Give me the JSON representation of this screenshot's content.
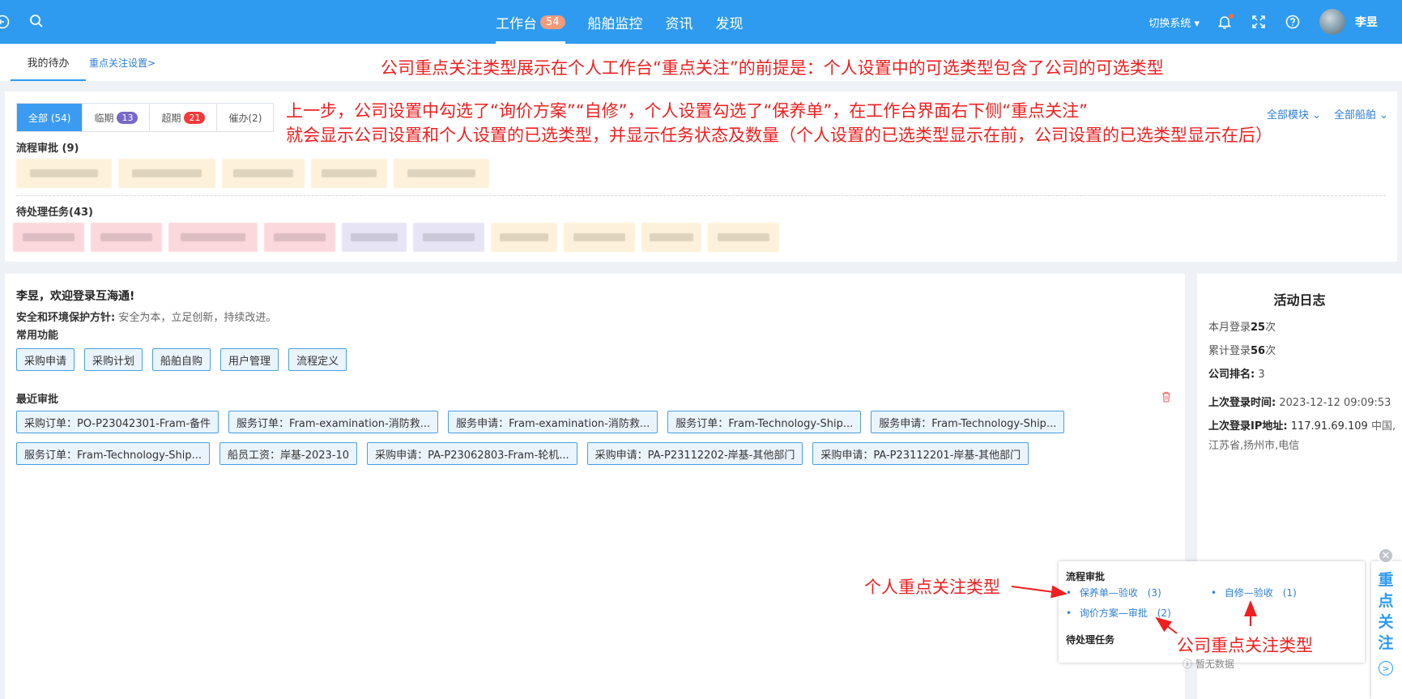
{
  "header": {
    "nav": [
      {
        "label": "工作台",
        "badge": "54"
      },
      {
        "label": "船舶监控"
      },
      {
        "label": "资讯"
      },
      {
        "label": "发现"
      }
    ],
    "switch_label": "切换系统",
    "user_name": "李昱"
  },
  "tabs": {
    "mine": "我的待办",
    "focus_settings": "重点关注设置>"
  },
  "annotations": {
    "top": "公司重点关注类型展示在个人工作台“重点关注”的前提是：个人设置中的可选类型包含了公司的可选类型",
    "line1": "上一步，公司设置中勾选了“询价方案”“自修”，个人设置勾选了“保养单”，在工作台界面右下侧“重点关注”",
    "line2": "就会显示公司设置和个人设置的已选类型，并显示任务状态及数量（个人设置的已选类型显示在前，公司设置的已选类型显示在后）",
    "personal": "个人重点关注类型",
    "company": "公司重点关注类型"
  },
  "todo": {
    "filters": [
      {
        "label": "全部 (54)"
      },
      {
        "label": "临期",
        "badge": "13"
      },
      {
        "label": "超期",
        "badge": "21"
      },
      {
        "label": "催办(2)"
      }
    ],
    "module_select": "全部模块",
    "ship_select": "全部船舶",
    "approval_label": "流程审批 (9)",
    "pending_label": "待处理任务(43)"
  },
  "welcome": {
    "title": "李昱，欢迎登录互海通!",
    "policy_label": "安全和环境保护方针:",
    "policy_value": "安全为本，立足创新，持续改进。",
    "common_label": "常用功能",
    "functions": [
      "采购申请",
      "采购计划",
      "船舶自购",
      "用户管理",
      "流程定义"
    ],
    "recent_label": "最近审批",
    "recent_row1": [
      "采购订单：PO-P23042301-Fram-备件",
      "服务订单：Fram-examination-消防救...",
      "服务申请：Fram-examination-消防救...",
      "服务订单：Fram-Technology-Ship...",
      "服务申请：Fram-Technology-Ship..."
    ],
    "recent_row2": [
      "服务订单：Fram-Technology-Ship...",
      "船员工资：岸基-2023-10",
      "采购申请：PA-P23062803-Fram-轮机...",
      "采购申请：PA-P23112202-岸基-其他部门",
      "采购申请：PA-P23112201-岸基-其他部门"
    ]
  },
  "activity": {
    "title": "活动日志",
    "month_prefix": "本月登录",
    "month_count": "25",
    "month_suffix": "次",
    "total_prefix": "累计登录",
    "total_count": "56",
    "total_suffix": "次",
    "rank_label": "公司排名:",
    "rank_value": "3",
    "last_login_label": "上次登录时间:",
    "last_login_value": "2023-12-12 09:09:53",
    "ip_label": "上次登录IP地址:",
    "ip_value": "117.91.69.109",
    "ip_location": "中国,江苏省,扬州市,电信"
  },
  "focus_panel": {
    "approval_label": "流程审批",
    "item_maint": "保养单—验收",
    "item_maint_count": "(3)",
    "item_self": "自修—验收",
    "item_self_count": "(1)",
    "item_inquiry": "询价方案—审批",
    "item_inquiry_count": "(2)",
    "pending_label": "待处理任务",
    "empty_text": "暂无数据",
    "side_label": "重点关注"
  }
}
